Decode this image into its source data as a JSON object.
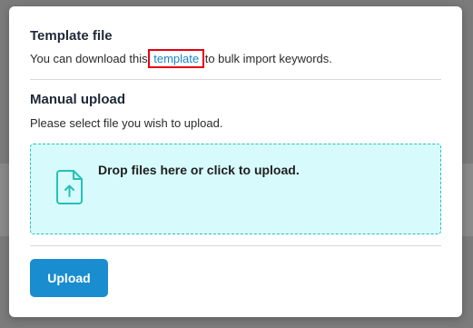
{
  "modal": {
    "template_section": {
      "title": "Template file",
      "text_before": "You can download this",
      "link_label": "template",
      "text_after": "to bulk import keywords."
    },
    "manual_section": {
      "title": "Manual upload",
      "instructions": "Please select file you wish to upload."
    },
    "dropzone": {
      "label": "Drop files here or click to upload.",
      "icon": "file-upload-icon"
    },
    "upload_button_label": "Upload"
  },
  "colors": {
    "accent": "#1a8dd0",
    "link": "#1a84c7",
    "highlight_box": "#e60012",
    "dropzone_bg": "#d7fbfc",
    "dropzone_border": "#25c1b7"
  }
}
